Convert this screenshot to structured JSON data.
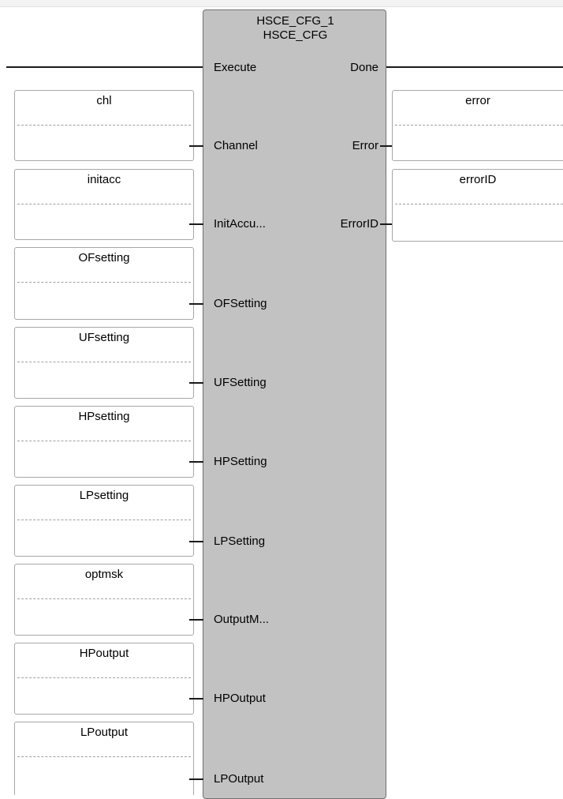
{
  "block": {
    "instance_name": "HSCE_CFG_1",
    "type_name": "HSCE_CFG"
  },
  "header_pins": {
    "execute": "Execute",
    "done": "Done"
  },
  "inputs": [
    {
      "variable": "chl",
      "pin": "Channel"
    },
    {
      "variable": "initacc",
      "pin": "InitAccu..."
    },
    {
      "variable": "OFsetting",
      "pin": "OFSetting"
    },
    {
      "variable": "UFsetting",
      "pin": "UFSetting"
    },
    {
      "variable": "HPsetting",
      "pin": "HPSetting"
    },
    {
      "variable": "LPsetting",
      "pin": "LPSetting"
    },
    {
      "variable": "optmsk",
      "pin": "OutputM..."
    },
    {
      "variable": "HPoutput",
      "pin": "HPOutput"
    },
    {
      "variable": "LPoutput",
      "pin": "LPOutput"
    }
  ],
  "outputs": [
    {
      "variable": "error",
      "pin": "Error"
    },
    {
      "variable": "errorID",
      "pin": "ErrorID"
    }
  ]
}
